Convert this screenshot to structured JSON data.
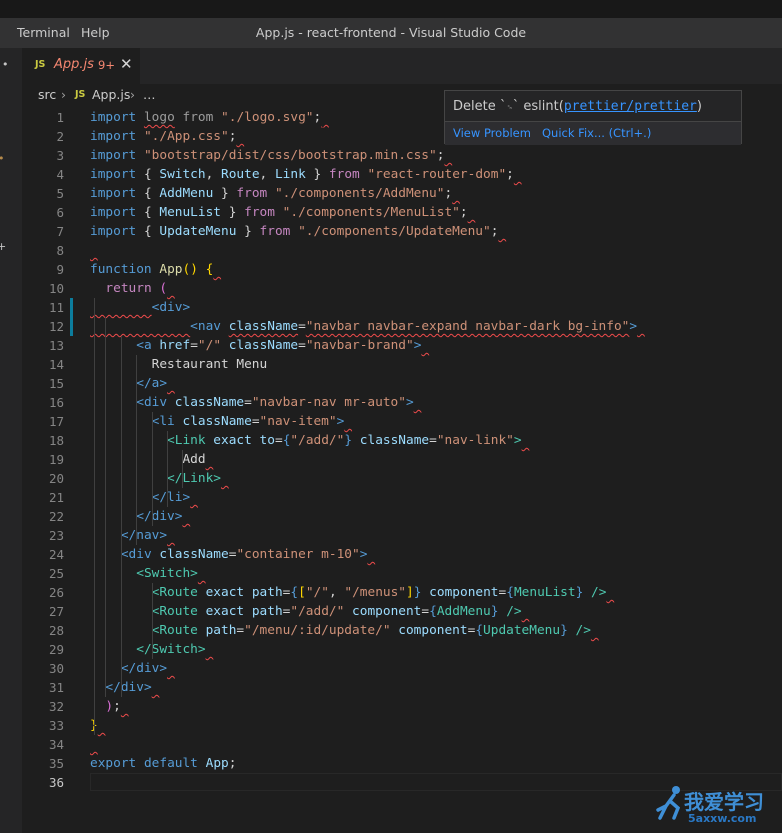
{
  "menu": {
    "items": [
      "Terminal",
      "Help"
    ]
  },
  "window": {
    "title": "App.js - react-frontend - Visual Studio Code"
  },
  "tab": {
    "icon": "JS",
    "name": "App.js",
    "problem_count": "9+",
    "close": "✕"
  },
  "breadcrumb": {
    "folder": "src",
    "separator": "›",
    "file_icon": "JS",
    "file": "App.js",
    "more": "…"
  },
  "hover": {
    "message_prefix": "Delete `",
    "cr_symbol": "␍",
    "message_mid": "` eslint(",
    "rule_link": "prettier/prettier",
    "message_suffix": ")",
    "view_problem": "View Problem",
    "quick_fix": "Quick Fix... (Ctrl+.)"
  },
  "editor": {
    "active_line": 36,
    "line_numbers": [
      "1",
      "2",
      "3",
      "4",
      "5",
      "6",
      "7",
      "8",
      "9",
      "10",
      "11",
      "12",
      "13",
      "14",
      "15",
      "16",
      "17",
      "18",
      "19",
      "20",
      "21",
      "22",
      "23",
      "24",
      "25",
      "26",
      "27",
      "28",
      "29",
      "30",
      "31",
      "32",
      "33",
      "34",
      "35",
      "36"
    ],
    "lines": [
      [
        [
          "kw",
          "import"
        ],
        [
          "pun",
          " "
        ],
        [
          "unused",
          "logo"
        ],
        [
          "pun",
          " "
        ],
        [
          "unused",
          "from"
        ],
        [
          "pun",
          " "
        ],
        [
          "str",
          "\"./logo.svg\""
        ],
        [
          "pun",
          ";"
        ]
      ],
      [
        [
          "kw",
          "import"
        ],
        [
          "pun",
          " "
        ],
        [
          "str",
          "\"./App.css\""
        ],
        [
          "pun",
          ";"
        ]
      ],
      [
        [
          "kw",
          "import"
        ],
        [
          "pun",
          " "
        ],
        [
          "str",
          "\"bootstrap/dist/css/bootstrap.min.css\""
        ],
        [
          "pun",
          ";"
        ]
      ],
      [
        [
          "kw",
          "import"
        ],
        [
          "pun",
          " { "
        ],
        [
          "var",
          "Switch"
        ],
        [
          "pun",
          ", "
        ],
        [
          "var",
          "Route"
        ],
        [
          "pun",
          ", "
        ],
        [
          "var",
          "Link"
        ],
        [
          "pun",
          " } "
        ],
        [
          "ctl",
          "from"
        ],
        [
          "pun",
          " "
        ],
        [
          "str",
          "\"react-router-dom\""
        ],
        [
          "pun",
          ";"
        ]
      ],
      [
        [
          "kw",
          "import"
        ],
        [
          "pun",
          " { "
        ],
        [
          "var",
          "AddMenu"
        ],
        [
          "pun",
          " } "
        ],
        [
          "ctl",
          "from"
        ],
        [
          "pun",
          " "
        ],
        [
          "str",
          "\"./components/AddMenu\""
        ],
        [
          "pun",
          ";"
        ]
      ],
      [
        [
          "kw",
          "import"
        ],
        [
          "pun",
          " { "
        ],
        [
          "var",
          "MenuList"
        ],
        [
          "pun",
          " } "
        ],
        [
          "ctl",
          "from"
        ],
        [
          "pun",
          " "
        ],
        [
          "str",
          "\"./components/MenuList\""
        ],
        [
          "pun",
          ";"
        ]
      ],
      [
        [
          "kw",
          "import"
        ],
        [
          "pun",
          " { "
        ],
        [
          "var",
          "UpdateMenu"
        ],
        [
          "pun",
          " } "
        ],
        [
          "ctl",
          "from"
        ],
        [
          "pun",
          " "
        ],
        [
          "str",
          "\"./components/UpdateMenu\""
        ],
        [
          "pun",
          ";"
        ]
      ],
      [],
      [
        [
          "kw",
          "function"
        ],
        [
          "pun",
          " "
        ],
        [
          "fn",
          "App"
        ],
        [
          "br",
          "()"
        ],
        [
          "pun",
          " "
        ],
        [
          "br",
          "{"
        ]
      ],
      [
        [
          "pun",
          "  "
        ],
        [
          "ctl",
          "return"
        ],
        [
          "pun",
          " "
        ],
        [
          "br2",
          "("
        ]
      ],
      [
        [
          "pun",
          "        "
        ],
        [
          "tag",
          "<div>"
        ]
      ],
      [
        [
          "pun",
          "             "
        ],
        [
          "tag",
          "<nav"
        ],
        [
          "pun",
          " "
        ],
        [
          "var",
          "className"
        ],
        [
          "pun",
          "="
        ],
        [
          "str",
          "\"navbar navbar-expand navbar-dark bg-info\""
        ],
        [
          "tag",
          ">"
        ]
      ],
      [
        [
          "pun",
          "      "
        ],
        [
          "tag",
          "<a"
        ],
        [
          "pun",
          " "
        ],
        [
          "var",
          "href"
        ],
        [
          "pun",
          "="
        ],
        [
          "str",
          "\"/\""
        ],
        [
          "pun",
          " "
        ],
        [
          "var",
          "className"
        ],
        [
          "pun",
          "="
        ],
        [
          "str",
          "\"navbar-brand\""
        ],
        [
          "tag",
          ">"
        ]
      ],
      [
        [
          "txt",
          "        Restaurant Menu"
        ]
      ],
      [
        [
          "pun",
          "      "
        ],
        [
          "tag",
          "</a>"
        ]
      ],
      [
        [
          "pun",
          "      "
        ],
        [
          "tag",
          "<div"
        ],
        [
          "pun",
          " "
        ],
        [
          "var",
          "className"
        ],
        [
          "pun",
          "="
        ],
        [
          "str",
          "\"navbar-nav mr-auto\""
        ],
        [
          "tag",
          ">"
        ]
      ],
      [
        [
          "pun",
          "        "
        ],
        [
          "tag",
          "<li"
        ],
        [
          "pun",
          " "
        ],
        [
          "var",
          "className"
        ],
        [
          "pun",
          "="
        ],
        [
          "str",
          "\"nav-item\""
        ],
        [
          "tag",
          ">"
        ]
      ],
      [
        [
          "pun",
          "          "
        ],
        [
          "comp",
          "<Link"
        ],
        [
          "pun",
          " "
        ],
        [
          "var",
          "exact"
        ],
        [
          "pun",
          " "
        ],
        [
          "var",
          "to"
        ],
        [
          "pun",
          "="
        ],
        [
          "kw",
          "{"
        ],
        [
          "str",
          "\"/add/\""
        ],
        [
          "kw",
          "}"
        ],
        [
          "pun",
          " "
        ],
        [
          "var",
          "className"
        ],
        [
          "pun",
          "="
        ],
        [
          "str",
          "\"nav-link\""
        ],
        [
          "comp",
          ">"
        ]
      ],
      [
        [
          "txt",
          "            Add"
        ]
      ],
      [
        [
          "pun",
          "          "
        ],
        [
          "comp",
          "</Link>"
        ]
      ],
      [
        [
          "pun",
          "        "
        ],
        [
          "tag",
          "</li>"
        ]
      ],
      [
        [
          "pun",
          "      "
        ],
        [
          "tag",
          "</div>"
        ]
      ],
      [
        [
          "pun",
          "    "
        ],
        [
          "tag",
          "</nav>"
        ]
      ],
      [
        [
          "pun",
          "    "
        ],
        [
          "tag",
          "<div"
        ],
        [
          "pun",
          " "
        ],
        [
          "var",
          "className"
        ],
        [
          "pun",
          "="
        ],
        [
          "str",
          "\"container m-10\""
        ],
        [
          "tag",
          ">"
        ]
      ],
      [
        [
          "pun",
          "      "
        ],
        [
          "comp",
          "<Switch>"
        ]
      ],
      [
        [
          "pun",
          "        "
        ],
        [
          "comp",
          "<Route"
        ],
        [
          "pun",
          " "
        ],
        [
          "var",
          "exact"
        ],
        [
          "pun",
          " "
        ],
        [
          "var",
          "path"
        ],
        [
          "pun",
          "="
        ],
        [
          "kw",
          "{"
        ],
        [
          "br",
          "["
        ],
        [
          "str",
          "\"/\""
        ],
        [
          "pun",
          ", "
        ],
        [
          "str",
          "\"/menus\""
        ],
        [
          "br",
          "]"
        ],
        [
          "kw",
          "}"
        ],
        [
          "pun",
          " "
        ],
        [
          "var",
          "component"
        ],
        [
          "pun",
          "="
        ],
        [
          "kw",
          "{"
        ],
        [
          "comp",
          "MenuList"
        ],
        [
          "kw",
          "}"
        ],
        [
          "pun",
          " "
        ],
        [
          "comp",
          "/>"
        ]
      ],
      [
        [
          "pun",
          "        "
        ],
        [
          "comp",
          "<Route"
        ],
        [
          "pun",
          " "
        ],
        [
          "var",
          "exact"
        ],
        [
          "pun",
          " "
        ],
        [
          "var",
          "path"
        ],
        [
          "pun",
          "="
        ],
        [
          "str",
          "\"/add/\""
        ],
        [
          "pun",
          " "
        ],
        [
          "var",
          "component"
        ],
        [
          "pun",
          "="
        ],
        [
          "kw",
          "{"
        ],
        [
          "comp",
          "AddMenu"
        ],
        [
          "kw",
          "}"
        ],
        [
          "pun",
          " "
        ],
        [
          "comp",
          "/>"
        ]
      ],
      [
        [
          "pun",
          "        "
        ],
        [
          "comp",
          "<Route"
        ],
        [
          "pun",
          " "
        ],
        [
          "var",
          "path"
        ],
        [
          "pun",
          "="
        ],
        [
          "str",
          "\"/menu/:id/update/\""
        ],
        [
          "pun",
          " "
        ],
        [
          "var",
          "component"
        ],
        [
          "pun",
          "="
        ],
        [
          "kw",
          "{"
        ],
        [
          "comp",
          "UpdateMenu"
        ],
        [
          "kw",
          "}"
        ],
        [
          "pun",
          " "
        ],
        [
          "comp",
          "/>"
        ]
      ],
      [
        [
          "pun",
          "      "
        ],
        [
          "comp",
          "</Switch>"
        ]
      ],
      [
        [
          "pun",
          "    "
        ],
        [
          "tag",
          "</div>"
        ]
      ],
      [
        [
          "pun",
          "  "
        ],
        [
          "tag",
          "</div>"
        ]
      ],
      [
        [
          "pun",
          "  "
        ],
        [
          "br2",
          ")"
        ],
        [
          "pun",
          ";"
        ]
      ],
      [
        [
          "br",
          "}"
        ]
      ],
      [],
      [
        [
          "kw",
          "export"
        ],
        [
          "pun",
          " "
        ],
        [
          "kw",
          "default"
        ],
        [
          "pun",
          " "
        ],
        [
          "var",
          "App"
        ],
        [
          "pun",
          ";"
        ]
      ],
      []
    ]
  },
  "watermark": {
    "text": "我爱学习",
    "url": "5axxw.com"
  },
  "colors": {
    "squiggle": "#f14c4c",
    "accent": "#3794ff",
    "tab_error": "#f48771"
  }
}
